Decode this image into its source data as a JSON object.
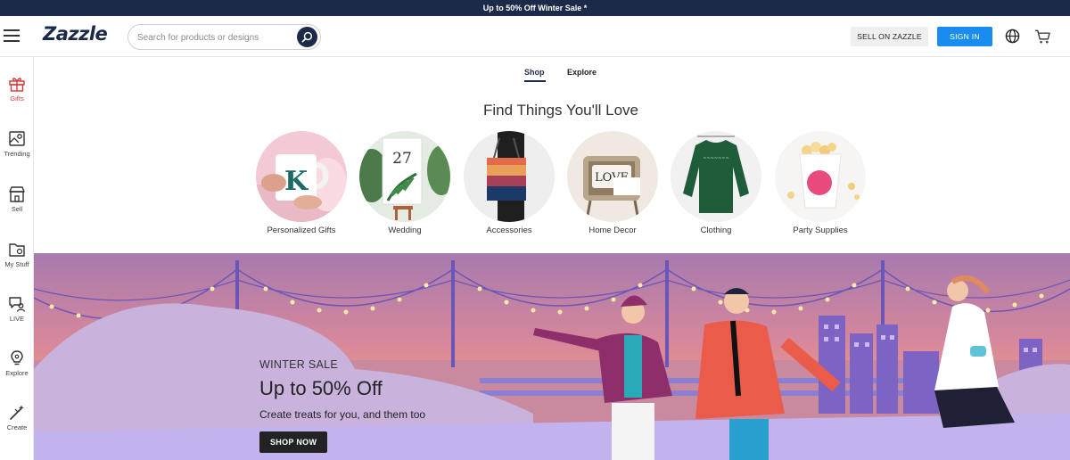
{
  "promo_banner": {
    "text": "Up to 50% Off Winter Sale *"
  },
  "header": {
    "logo": "Zazzle",
    "search": {
      "placeholder": "Search for products or designs",
      "value": ""
    },
    "sell_label": "SELL ON ZAZZLE",
    "signin_label": "SIGN IN",
    "icons": [
      "menu-icon",
      "search-icon",
      "globe-icon",
      "cart-icon"
    ]
  },
  "sidebar": {
    "items": [
      {
        "label": "Gifts",
        "icon": "gift-icon",
        "active": true
      },
      {
        "label": "Trending",
        "icon": "trending-icon"
      },
      {
        "label": "Sell",
        "icon": "storefront-icon"
      },
      {
        "label": "My Stuff",
        "icon": "folder-icon"
      },
      {
        "label": "LIVE",
        "icon": "live-chat-icon"
      },
      {
        "label": "Explore",
        "icon": "lightbulb-icon"
      },
      {
        "label": "Create",
        "icon": "magic-wand-icon"
      }
    ]
  },
  "tabs": [
    {
      "label": "Shop",
      "active": true
    },
    {
      "label": "Explore",
      "active": false
    }
  ],
  "section_title": "Find Things You'll Love",
  "categories": [
    {
      "label": "Personalized Gifts"
    },
    {
      "label": "Wedding",
      "image_text": "27"
    },
    {
      "label": "Accessories"
    },
    {
      "label": "Home Decor",
      "image_text": "LOVE"
    },
    {
      "label": "Clothing"
    },
    {
      "label": "Party Supplies"
    }
  ],
  "mug_letter": "K",
  "hero": {
    "eyebrow": "WINTER SALE",
    "headline": "Up to 50% Off",
    "subtext": "Create treats for you, and them too",
    "cta": "SHOP NOW"
  },
  "colors": {
    "navy": "#1c2a4a",
    "sign_in_blue": "#1a8cf0",
    "active_red": "#d33a3a",
    "banner_purple": "#b68ab8"
  }
}
